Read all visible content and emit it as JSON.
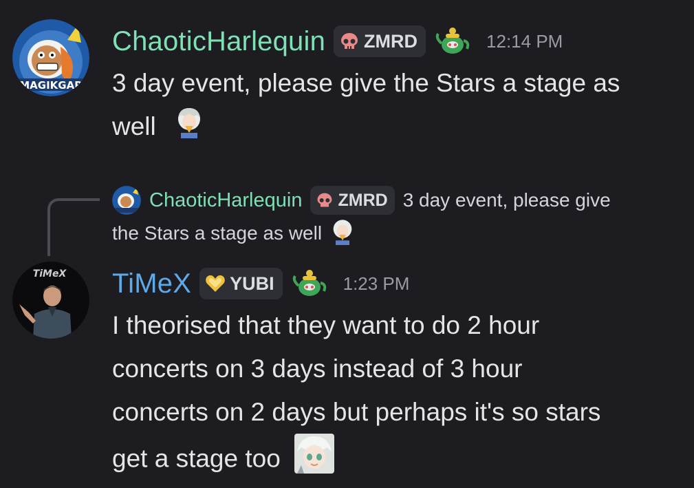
{
  "messages": [
    {
      "username": "ChaoticHarlequin",
      "username_color": "#7fe0b5",
      "tag": "ZMRD",
      "tag_icon": "skull-icon",
      "decoration": "teapot-icon",
      "timestamp": "12:14 PM",
      "avatar_text": "MAGIKGAR",
      "lines": [
        "3 day event, please give the Stars a stage as",
        "well"
      ]
    },
    {
      "username": "TiMeX",
      "username_color": "#5ea9e8",
      "tag": "YUBI",
      "tag_icon": "heart-icon",
      "decoration": "teapot-icon",
      "timestamp": "1:23 PM",
      "avatar_text": "TiMeX",
      "reply": {
        "username": "ChaoticHarlequin",
        "tag": "ZMRD",
        "text_line1": "3 day event, please give",
        "text_line2": "the Stars a stage as well"
      },
      "lines": [
        "I theorised that they want to do 2 hour",
        "concerts on 3 days instead of 3 hour",
        "concerts on 2 days but perhaps it's so stars",
        "get a stage too"
      ]
    }
  ]
}
